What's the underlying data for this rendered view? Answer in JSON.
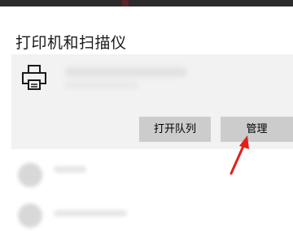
{
  "section": {
    "title": "打印机和扫描仪"
  },
  "printer_card": {
    "icon": "printer-icon",
    "buttons": {
      "open_queue": "打开队列",
      "manage": "管理"
    }
  },
  "annotation": {
    "arrow_color": "#e0201b",
    "arrow_target": "manage-button"
  },
  "colors": {
    "card_background": "#f2f2f2",
    "button_background": "#cccccc",
    "top_bar": "#2b2b2b"
  }
}
